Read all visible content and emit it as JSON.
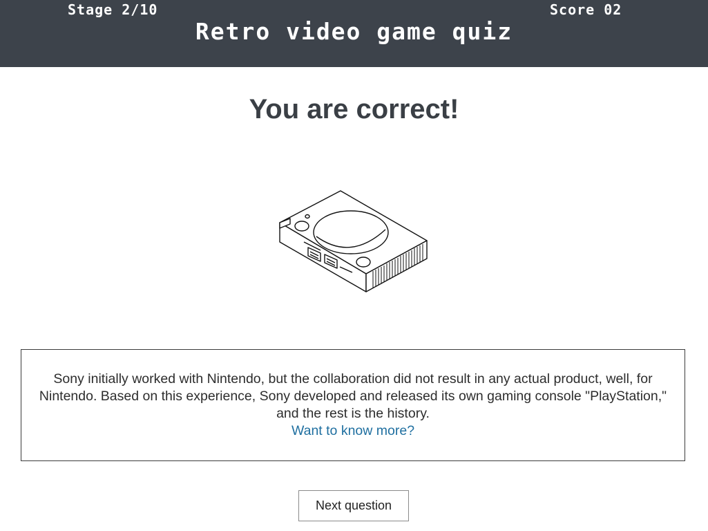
{
  "header": {
    "stage": "Stage 2/10",
    "score": "Score 02",
    "title": "Retro video game quiz"
  },
  "result": {
    "heading": "You are correct!",
    "image_icon": "playstation-console-icon"
  },
  "info": {
    "text": "Sony initially worked with Nintendo, but the collaboration did not result in any actual product, well, for Nintendo. Based on this experience, Sony developed and released its own gaming console \"PlayStation,\" and the rest is the history.",
    "link_label": "Want to know more?"
  },
  "actions": {
    "next_label": "Next question"
  },
  "colors": {
    "header_bg": "#3d434b",
    "heading_text": "#3a3f45",
    "link": "#1f6fa0"
  }
}
